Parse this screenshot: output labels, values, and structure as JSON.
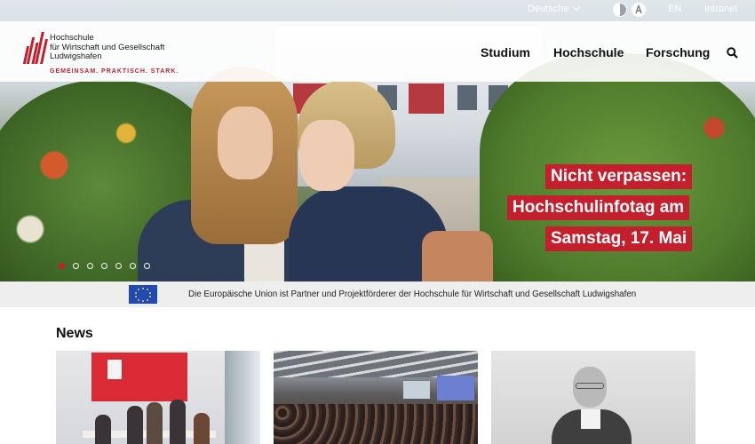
{
  "topbar": {
    "language_select": "Deutsche",
    "language_alt": "EN",
    "intranet": "Intranet"
  },
  "header": {
    "logo_lines": [
      "Hochschule",
      "für Wirtschaft und Gesellschaft",
      "Ludwigshafen"
    ],
    "tagline": "GEMEINSAM. PRAKTISCH. STARK.",
    "nav": [
      "Studium",
      "Hochschule",
      "Forschung"
    ]
  },
  "hero": {
    "headline_lines": [
      "Nicht verpassen:",
      "Hochschulinfotag am",
      "Samstag, 17. Mai"
    ],
    "slide_count": 7,
    "active_slide": 1
  },
  "eu_bar": {
    "text": "Die Europäische Union ist Partner und Projektförderer der Hochschule für Wirtschaft und Gesellschaft Ludwigshafen"
  },
  "news": {
    "title": "News",
    "cards": [
      {
        "icon": "photo-students-icon"
      },
      {
        "icon": "photo-lecture-hall-icon"
      },
      {
        "icon": "photo-portrait-icon"
      }
    ]
  },
  "colors": {
    "brand_red": "#c41f2c",
    "eu_blue": "#1f4bb2",
    "eu_bar_bg": "#eeeeee"
  }
}
